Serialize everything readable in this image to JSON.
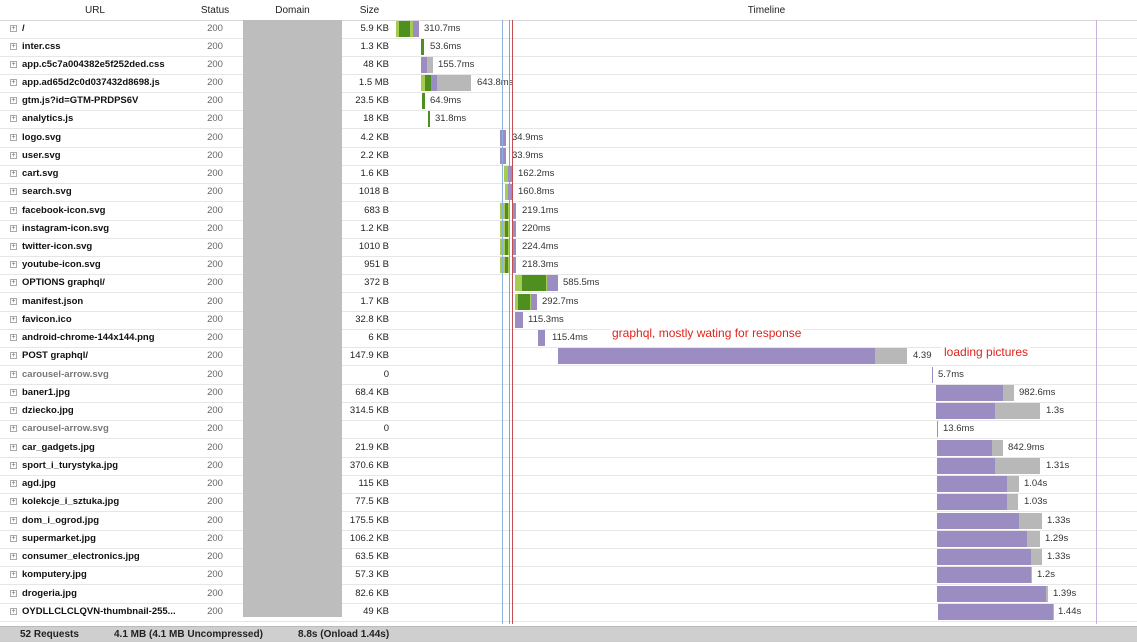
{
  "columns": {
    "url": "URL",
    "status": "Status",
    "domain": "Domain",
    "size": "Size",
    "timeline": "Timeline"
  },
  "requests": [
    {
      "url": "/",
      "status": "200",
      "size": "5.9 KB",
      "duration": "310.7ms"
    },
    {
      "url": "inter.css",
      "status": "200",
      "size": "1.3 KB",
      "duration": "53.6ms"
    },
    {
      "url": "app.c5c7a004382e5f252ded.css",
      "status": "200",
      "size": "48 KB",
      "duration": "155.7ms"
    },
    {
      "url": "app.ad65d2c0d037432d8698.js",
      "status": "200",
      "size": "1.5 MB",
      "duration": "643.8ms"
    },
    {
      "url": "gtm.js?id=GTM-PRDPS6V",
      "status": "200",
      "size": "23.5 KB",
      "duration": "64.9ms"
    },
    {
      "url": "analytics.js",
      "status": "200",
      "size": "18 KB",
      "duration": "31.8ms"
    },
    {
      "url": "logo.svg",
      "status": "200",
      "size": "4.2 KB",
      "duration": "34.9ms"
    },
    {
      "url": "user.svg",
      "status": "200",
      "size": "2.2 KB",
      "duration": "33.9ms"
    },
    {
      "url": "cart.svg",
      "status": "200",
      "size": "1.6 KB",
      "duration": "162.2ms"
    },
    {
      "url": "search.svg",
      "status": "200",
      "size": "1018 B",
      "duration": "160.8ms"
    },
    {
      "url": "facebook-icon.svg",
      "status": "200",
      "size": "683 B",
      "duration": "219.1ms"
    },
    {
      "url": "instagram-icon.svg",
      "status": "200",
      "size": "1.2 KB",
      "duration": "220ms"
    },
    {
      "url": "twitter-icon.svg",
      "status": "200",
      "size": "1010 B",
      "duration": "224.4ms"
    },
    {
      "url": "youtube-icon.svg",
      "status": "200",
      "size": "951 B",
      "duration": "218.3ms"
    },
    {
      "url": "OPTIONS graphql/",
      "status": "200",
      "size": "372 B",
      "duration": "585.5ms"
    },
    {
      "url": "manifest.json",
      "status": "200",
      "size": "1.7 KB",
      "duration": "292.7ms"
    },
    {
      "url": "favicon.ico",
      "status": "200",
      "size": "32.8 KB",
      "duration": "115.3ms"
    },
    {
      "url": "android-chrome-144x144.png",
      "status": "200",
      "size": "6 KB",
      "duration": "115.4ms"
    },
    {
      "url": "POST graphql/",
      "status": "200",
      "size": "147.9 KB",
      "duration": "4.39"
    },
    {
      "url": "carousel-arrow.svg",
      "status": "200",
      "size": "0",
      "duration": "5.7ms",
      "cached": true
    },
    {
      "url": "baner1.jpg",
      "status": "200",
      "size": "68.4 KB",
      "duration": "982.6ms"
    },
    {
      "url": "dziecko.jpg",
      "status": "200",
      "size": "314.5 KB",
      "duration": "1.3s"
    },
    {
      "url": "carousel-arrow.svg",
      "status": "200",
      "size": "0",
      "duration": "13.6ms",
      "cached": true
    },
    {
      "url": "car_gadgets.jpg",
      "status": "200",
      "size": "21.9 KB",
      "duration": "842.9ms"
    },
    {
      "url": "sport_i_turystyka.jpg",
      "status": "200",
      "size": "370.6 KB",
      "duration": "1.31s"
    },
    {
      "url": "agd.jpg",
      "status": "200",
      "size": "115 KB",
      "duration": "1.04s"
    },
    {
      "url": "kolekcje_i_sztuka.jpg",
      "status": "200",
      "size": "77.5 KB",
      "duration": "1.03s"
    },
    {
      "url": "dom_i_ogrod.jpg",
      "status": "200",
      "size": "175.5 KB",
      "duration": "1.33s"
    },
    {
      "url": "supermarket.jpg",
      "status": "200",
      "size": "106.2 KB",
      "duration": "1.29s"
    },
    {
      "url": "consumer_electronics.jpg",
      "status": "200",
      "size": "63.5 KB",
      "duration": "1.33s"
    },
    {
      "url": "komputery.jpg",
      "status": "200",
      "size": "57.3 KB",
      "duration": "1.2s"
    },
    {
      "url": "drogeria.jpg",
      "status": "200",
      "size": "82.6 KB",
      "duration": "1.39s"
    },
    {
      "url": "OYDLLCLCLQVN-thumbnail-255...",
      "status": "200",
      "size": "49 KB",
      "duration": "1.44s"
    }
  ],
  "annotations": {
    "graphql": "graphql, mostly wating for response",
    "pictures": "loading pictures"
  },
  "footer": {
    "requests": "52 Requests",
    "size": "4.1 MB  (4.1 MB Uncompressed)",
    "time": "8.8s  (Onload 1.44s)"
  },
  "colors": {
    "waiting": "#b8b8b8",
    "receiving": "#9b8dc2",
    "sending": "#a4cc52",
    "connecting": "#4f8f1f",
    "annotation": "#e0241c"
  }
}
